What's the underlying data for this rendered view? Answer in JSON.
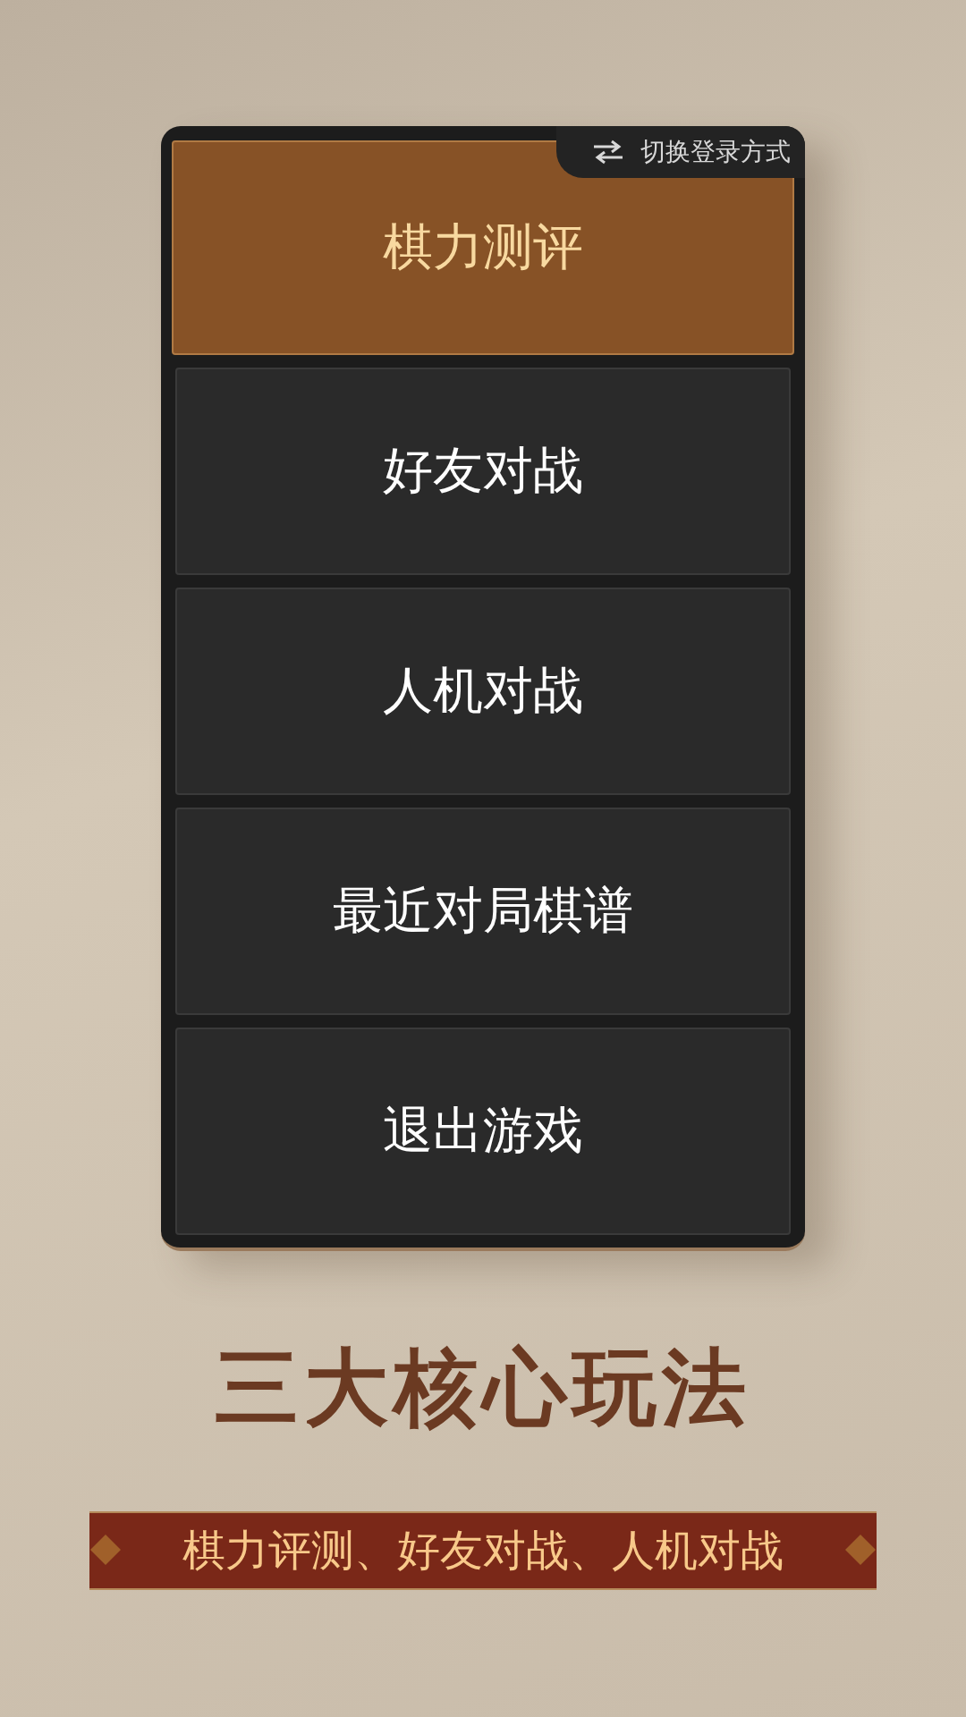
{
  "switch_login": {
    "label": "切换登录方式"
  },
  "menu": [
    {
      "label": "棋力测评",
      "selected": true
    },
    {
      "label": "好友对战",
      "selected": false
    },
    {
      "label": "人机对战",
      "selected": false
    },
    {
      "label": "最近对局棋谱",
      "selected": false
    },
    {
      "label": "退出游戏",
      "selected": false
    }
  ],
  "headline": "三大核心玩法",
  "subtitle": "棋力评测、好友对战、人机对战"
}
